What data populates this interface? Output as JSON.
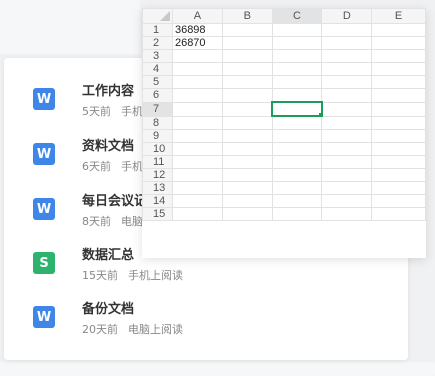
{
  "files": [
    {
      "icon": "W",
      "kind": "writer",
      "title": "工作内容",
      "age": "5天前",
      "source": "手机上阅读"
    },
    {
      "icon": "W",
      "kind": "writer",
      "title": "资料文档",
      "age": "6天前",
      "source": "手机上阅读"
    },
    {
      "icon": "W",
      "kind": "writer",
      "title": "每日会议记录",
      "age": "8天前",
      "source": "电脑上阅读"
    },
    {
      "icon": "S",
      "kind": "sheet",
      "title": "数据汇总",
      "age": "15天前",
      "source": "手机上阅读"
    },
    {
      "icon": "W",
      "kind": "writer",
      "title": "备份文档",
      "age": "20天前",
      "source": "电脑上阅读"
    }
  ],
  "sheet": {
    "columns": [
      "A",
      "B",
      "C",
      "D",
      "E"
    ],
    "rows": [
      "1",
      "2",
      "3",
      "4",
      "5",
      "6",
      "7",
      "8",
      "9",
      "10",
      "11",
      "12",
      "13",
      "14",
      "15"
    ],
    "cells": {
      "A1": "36898",
      "A2": "26870"
    },
    "active_cell": "C7"
  },
  "colors": {
    "writer": "#3e86e8",
    "sheet": "#2eb36e",
    "selection": "#1c9b5b"
  }
}
